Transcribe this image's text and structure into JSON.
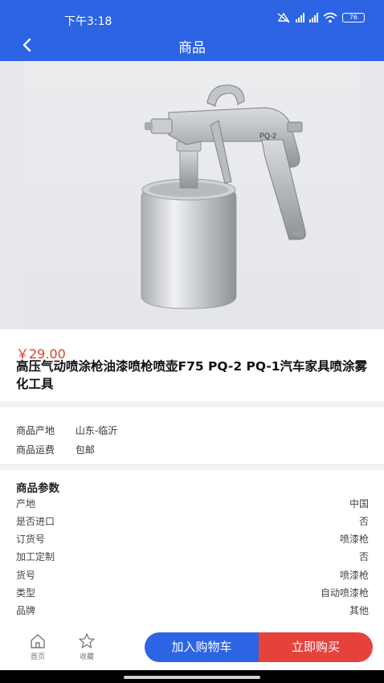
{
  "status_bar": {
    "time": "下午3:18",
    "battery": "76"
  },
  "nav": {
    "title": "商品"
  },
  "product": {
    "price": "￥29.00",
    "title": "高压气动喷涂枪油漆喷枪喷壶F75 PQ-2 PQ-1汽车家具喷涂雾化工具",
    "image_label": "PQ-2"
  },
  "info": [
    {
      "label": "商品产地",
      "value": "山东-临沂"
    },
    {
      "label": "商品运费",
      "value": "包邮"
    }
  ],
  "params": {
    "title": "商品参数",
    "rows": [
      {
        "key": "产地",
        "value": "中国"
      },
      {
        "key": "是否进口",
        "value": "否"
      },
      {
        "key": "订货号",
        "value": "喷漆枪"
      },
      {
        "key": "加工定制",
        "value": "否"
      },
      {
        "key": "货号",
        "value": "喷漆枪"
      },
      {
        "key": "类型",
        "value": "自动喷漆枪"
      },
      {
        "key": "品牌",
        "value": "其他"
      }
    ]
  },
  "bottom_bar": {
    "home_label": "首页",
    "favorite_label": "收藏",
    "add_to_cart_label": "加入购物车",
    "buy_now_label": "立即购买"
  },
  "colors": {
    "primary": "#2c64e3",
    "buy": "#e6423c",
    "price": "#d9402a"
  }
}
